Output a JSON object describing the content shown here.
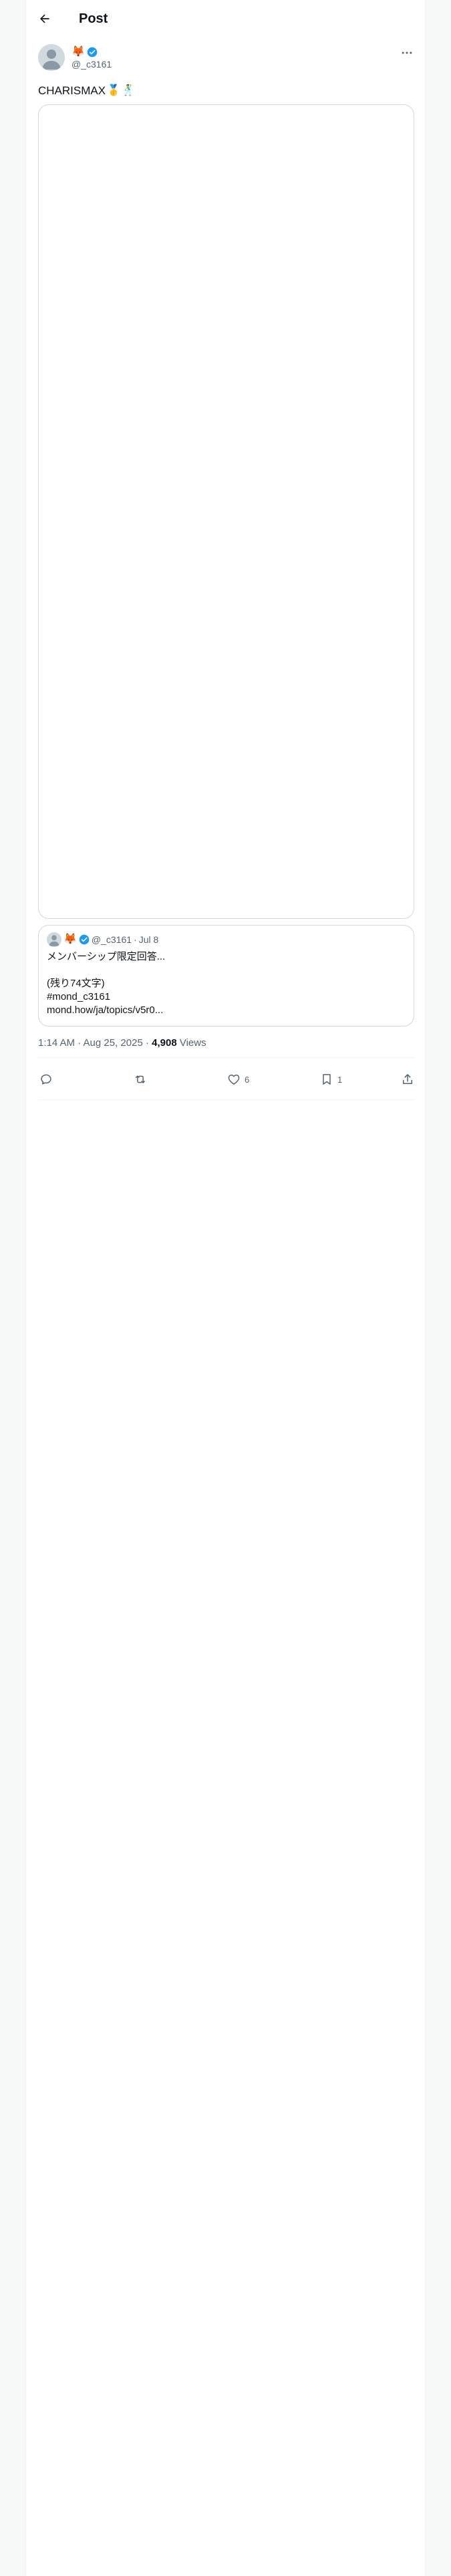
{
  "header": {
    "title": "Post"
  },
  "author": {
    "display_name_emoji": "🦊",
    "handle": "@_c3161"
  },
  "post": {
    "text": "CHARISMAX",
    "emoji_1": "🥇",
    "emoji_2": "🕺"
  },
  "quote": {
    "emoji": "🦊",
    "handle": "@_c3161",
    "separator": "·",
    "date": "Jul 8",
    "lines": [
      "メンバーシップ限定回答...",
      "",
      "(残り74文字)",
      "#mond_c3161",
      "mond.how/ja/topics/v5r0..."
    ]
  },
  "meta": {
    "time": "1:14 AM · Aug 25, 2025 · ",
    "views_count": "4,908",
    "views_label": " Views"
  },
  "actions": {
    "reply_count": "",
    "repost_count": "",
    "like_count": "6",
    "bookmark_count": "1"
  },
  "colors": {
    "verified": "#1d9bf0",
    "secondary_text": "#536471",
    "border": "#cfd9de"
  }
}
